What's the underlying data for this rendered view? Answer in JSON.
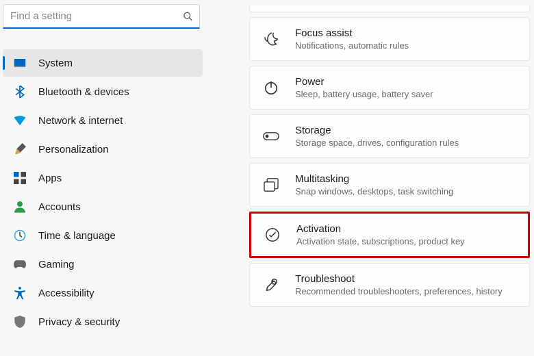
{
  "search": {
    "placeholder": "Find a setting"
  },
  "sidebar": {
    "items": [
      {
        "label": "System",
        "icon": "system",
        "active": true
      },
      {
        "label": "Bluetooth & devices",
        "icon": "bluetooth"
      },
      {
        "label": "Network & internet",
        "icon": "network"
      },
      {
        "label": "Personalization",
        "icon": "personalization"
      },
      {
        "label": "Apps",
        "icon": "apps"
      },
      {
        "label": "Accounts",
        "icon": "accounts"
      },
      {
        "label": "Time & language",
        "icon": "time"
      },
      {
        "label": "Gaming",
        "icon": "gaming"
      },
      {
        "label": "Accessibility",
        "icon": "accessibility"
      },
      {
        "label": "Privacy & security",
        "icon": "privacy"
      }
    ]
  },
  "panels": [
    {
      "title": "Focus assist",
      "sub": "Notifications, automatic rules",
      "icon": "focus"
    },
    {
      "title": "Power",
      "sub": "Sleep, battery usage, battery saver",
      "icon": "power"
    },
    {
      "title": "Storage",
      "sub": "Storage space, drives, configuration rules",
      "icon": "storage"
    },
    {
      "title": "Multitasking",
      "sub": "Snap windows, desktops, task switching",
      "icon": "multitask"
    },
    {
      "title": "Activation",
      "sub": "Activation state, subscriptions, product key",
      "icon": "activation",
      "highlight": true
    },
    {
      "title": "Troubleshoot",
      "sub": "Recommended troubleshooters, preferences, history",
      "icon": "troubleshoot"
    }
  ]
}
